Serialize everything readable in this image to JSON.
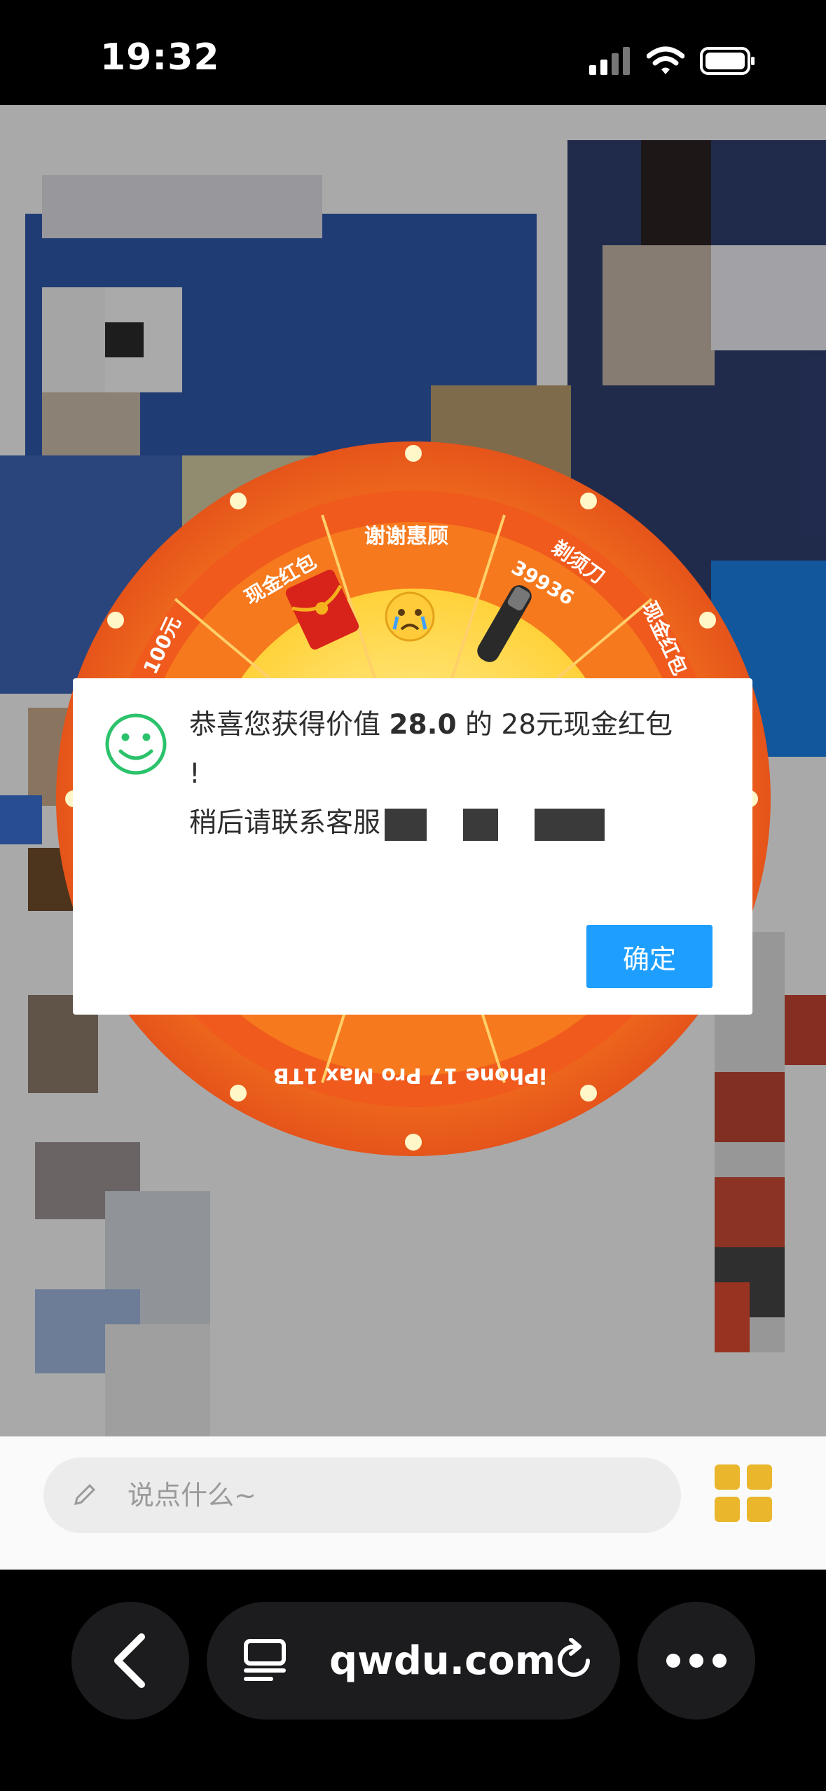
{
  "status_bar": {
    "time": "19:32"
  },
  "wheel": {
    "prizes": [
      "谢谢惠顾",
      "剃须刀",
      "现金红包",
      "iPhone 17 Pro Max 1TB"
    ],
    "partial_labels": [
      "现金红包",
      "39936",
      "100元"
    ]
  },
  "dialog": {
    "icon": "smile-icon",
    "message_prefix": "恭喜您获得价值 ",
    "value": "28.0",
    "message_middle": " 的 28元现金红包",
    "message_end": "!",
    "line2_prefix": "稍后请联系客服",
    "confirm_label": "确定"
  },
  "chat_input": {
    "placeholder": "说点什么~"
  },
  "browser": {
    "url": "qwdu.com"
  },
  "colors": {
    "accent": "#1e9fff",
    "wheel_orange": "#f0641e",
    "wheel_yellow": "#ffd84a",
    "smile_green": "#2bc26b"
  }
}
